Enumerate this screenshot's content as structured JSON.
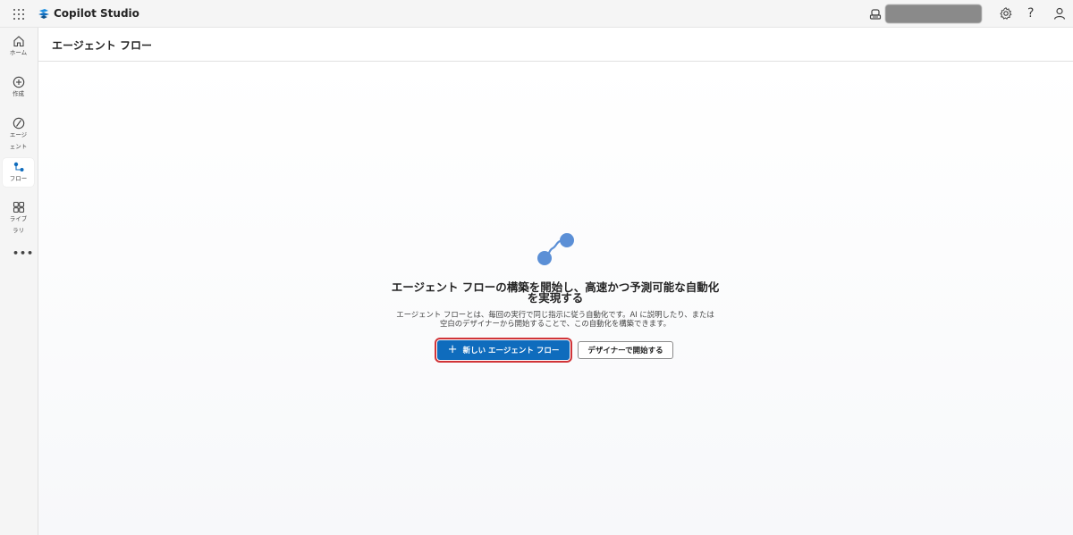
{
  "app": {
    "title": "Copilot Studio"
  },
  "rail": {
    "items": [
      {
        "label": "ホーム",
        "icon": "home-icon"
      },
      {
        "label": "作成",
        "icon": "plus-circle-icon"
      },
      {
        "label": "エージェント",
        "icon": "agent-icon"
      },
      {
        "label": "フロー",
        "icon": "flow-icon",
        "active": true
      },
      {
        "label": "ライブラリ",
        "icon": "library-icon"
      }
    ],
    "more_label": "•••"
  },
  "header": {
    "title": "エージェント フロー"
  },
  "empty_state": {
    "title": "エージェント フローの構築を開始し、高速かつ予測可能な自動化を実現する",
    "description": "エージェント フローとは、毎回の実行で同じ指示に従う自動化です。AI に説明したり、または空白のデザイナーから開始することで、この自動化を構築できます。",
    "primary_button": "新しい エージェント フロー",
    "secondary_button": "デザイナーで開始する"
  },
  "colors": {
    "accent": "#0f6cbd",
    "highlight_outline": "#d13438",
    "hero_icon": "#5b8fd6"
  }
}
